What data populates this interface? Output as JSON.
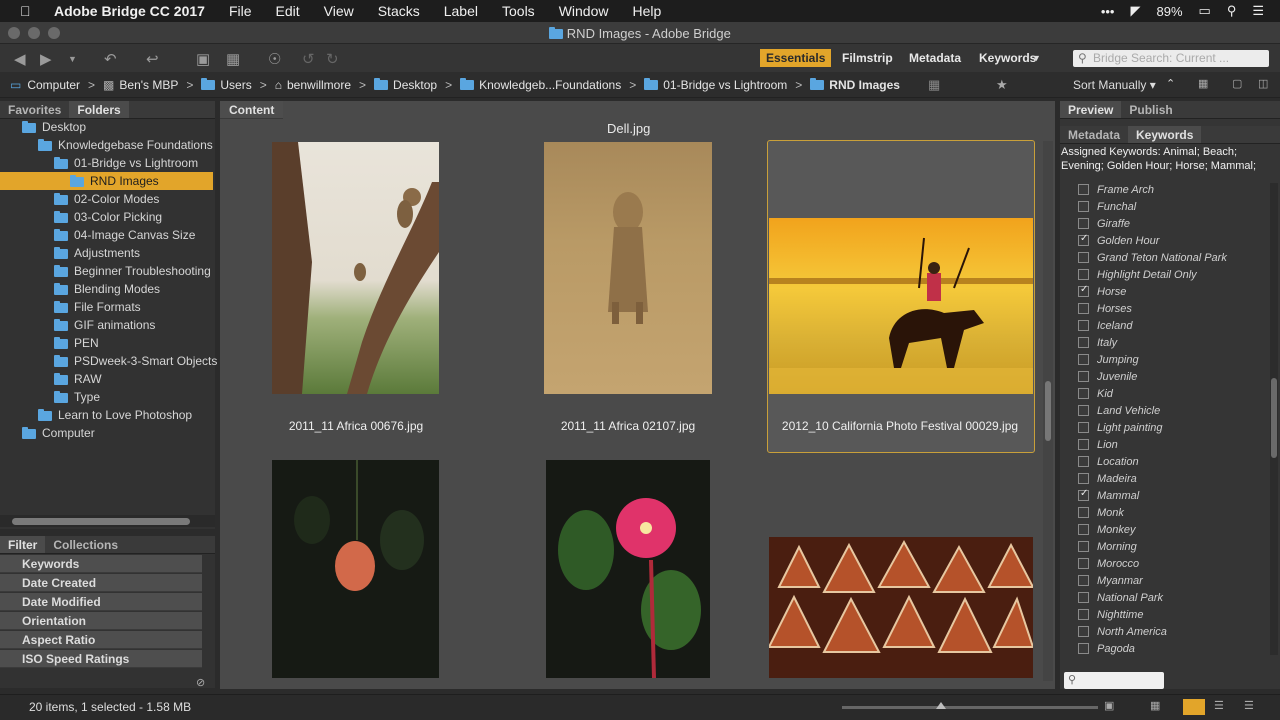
{
  "menubar": {
    "app_name": "Adobe Bridge CC 2017",
    "items": [
      "File",
      "Edit",
      "View",
      "Stacks",
      "Label",
      "Tools",
      "Window",
      "Help"
    ],
    "battery": "89%",
    "more": "•••"
  },
  "window": {
    "title": "RND Images - Adobe Bridge"
  },
  "toolbar": {
    "workspaces": [
      "Essentials",
      "Filmstrip",
      "Metadata",
      "Keywords"
    ],
    "search_placeholder": "Bridge Search: Current ..."
  },
  "path": {
    "crumbs": [
      "Computer",
      "Ben's MBP",
      "Users",
      "benwillmore",
      "Desktop",
      "Knowledgeb...Foundations",
      "01-Bridge vs Lightroom",
      "RND Images"
    ],
    "sort_label": "Sort Manually"
  },
  "left_panel": {
    "tabs": [
      "Favorites",
      "Folders"
    ],
    "tree": [
      {
        "label": "Desktop",
        "indent": 1
      },
      {
        "label": "Knowledgebase Foundations",
        "indent": 2
      },
      {
        "label": "01-Bridge vs Lightroom",
        "indent": 3
      },
      {
        "label": "RND Images",
        "indent": 4,
        "selected": true
      },
      {
        "label": "02-Color Modes",
        "indent": 3
      },
      {
        "label": "03-Color Picking",
        "indent": 3
      },
      {
        "label": "04-Image Canvas Size",
        "indent": 3
      },
      {
        "label": "Adjustments",
        "indent": 3
      },
      {
        "label": "Beginner Troubleshooting",
        "indent": 3
      },
      {
        "label": "Blending Modes",
        "indent": 3
      },
      {
        "label": "File Formats",
        "indent": 3
      },
      {
        "label": "GIF animations",
        "indent": 3
      },
      {
        "label": "PEN",
        "indent": 3
      },
      {
        "label": "PSDweek-3-Smart Objects",
        "indent": 3
      },
      {
        "label": "RAW",
        "indent": 3
      },
      {
        "label": "Type",
        "indent": 3
      },
      {
        "label": "Learn to Love Photoshop",
        "indent": 2
      },
      {
        "label": "Computer",
        "indent": 1
      }
    ]
  },
  "filter_panel": {
    "tabs": [
      "Filter",
      "Collections"
    ],
    "rows": [
      "Keywords",
      "Date Created",
      "Date Modified",
      "Orientation",
      "Aspect Ratio",
      "ISO Speed Ratings"
    ]
  },
  "content": {
    "tab": "Content",
    "top_filename": "Dell.jpg",
    "thumbnails": [
      {
        "caption": "2011_11 Africa 00676.jpg"
      },
      {
        "caption": "2011_11 Africa 02107.jpg"
      },
      {
        "caption": "2012_10 California Photo Festival 00029.jpg",
        "selected": true
      }
    ]
  },
  "right_panel": {
    "top_tabs": [
      "Preview",
      "Publish"
    ],
    "sub_tabs": [
      "Metadata",
      "Keywords"
    ],
    "assigned": "Assigned Keywords: Animal; Beach; Evening; Golden Hour; Horse; Mammal;",
    "keywords": [
      {
        "label": "Frame Arch",
        "checked": false
      },
      {
        "label": "Funchal",
        "checked": false
      },
      {
        "label": "Giraffe",
        "checked": false
      },
      {
        "label": "Golden Hour",
        "checked": true
      },
      {
        "label": "Grand Teton National Park",
        "checked": false
      },
      {
        "label": "Highlight Detail Only",
        "checked": false
      },
      {
        "label": "Horse",
        "checked": true
      },
      {
        "label": "Horses",
        "checked": false
      },
      {
        "label": "Iceland",
        "checked": false
      },
      {
        "label": "Italy",
        "checked": false
      },
      {
        "label": "Jumping",
        "checked": false
      },
      {
        "label": "Juvenile",
        "checked": false
      },
      {
        "label": "Kid",
        "checked": false
      },
      {
        "label": "Land Vehicle",
        "checked": false
      },
      {
        "label": "Light painting",
        "checked": false
      },
      {
        "label": "Lion",
        "checked": false
      },
      {
        "label": "Location",
        "checked": false
      },
      {
        "label": "Madeira",
        "checked": false
      },
      {
        "label": "Mammal",
        "checked": true
      },
      {
        "label": "Monk",
        "checked": false
      },
      {
        "label": "Monkey",
        "checked": false
      },
      {
        "label": "Morning",
        "checked": false
      },
      {
        "label": "Morocco",
        "checked": false
      },
      {
        "label": "Myanmar",
        "checked": false
      },
      {
        "label": "National Park",
        "checked": false
      },
      {
        "label": "Nighttime",
        "checked": false
      },
      {
        "label": "North America",
        "checked": false
      },
      {
        "label": "Pagoda",
        "checked": false
      }
    ]
  },
  "status": {
    "text": "20 items, 1 selected - 1.58 MB"
  },
  "colors": {
    "accent": "#e2a52a",
    "folder": "#5aa6e0",
    "panel": "#323232",
    "content": "#4a4a4a"
  }
}
